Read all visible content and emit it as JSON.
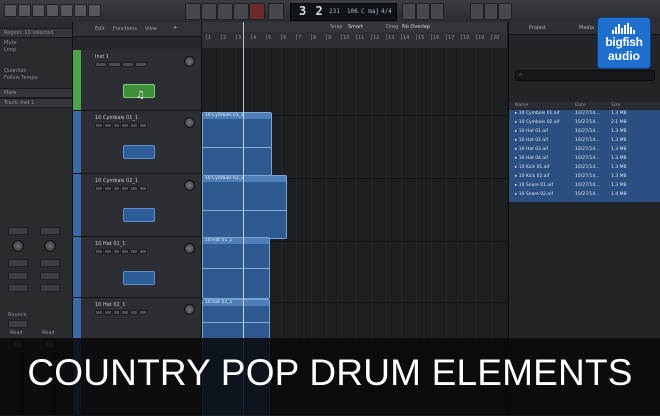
{
  "lcd": {
    "bars": "3 2",
    "beat": "231",
    "tempo": "106",
    "key": "C maj",
    "sig": "4/4"
  },
  "ruler": {
    "mode": "Snap",
    "snap_value": "Smart",
    "drag_label": "Drag",
    "drag_mode": "No Overlap",
    "bars": [
      "1",
      "2",
      "3",
      "4",
      "5",
      "6",
      "7",
      "8",
      "9",
      "10",
      "11",
      "12",
      "13",
      "14",
      "15",
      "16",
      "17",
      "18",
      "19",
      "20"
    ]
  },
  "inspector": {
    "region_label": "Region: 10 selected",
    "rows": [
      "Mute",
      "Loop",
      "",
      "Quantize",
      "Follow Tempo",
      "More"
    ],
    "track_label": "Track: Inst 1",
    "bottom": [
      "Bounce",
      "Read",
      "Read"
    ]
  },
  "track_toolbar": {
    "edit": "Edit",
    "functions": "Functions",
    "view": "View"
  },
  "tracks": [
    {
      "name": "Inst 1",
      "color": "#4aa54a"
    },
    {
      "name": "10 Cymbals 01_1",
      "color": "#3a69a6"
    },
    {
      "name": "10 Cymbals 02_1",
      "color": "#3a69a6"
    },
    {
      "name": "10 Hat 01_1",
      "color": "#3a69a6"
    },
    {
      "name": "10 Hat 02_1",
      "color": "#3a69a6"
    }
  ],
  "regions": [
    "10 Cymbals 01_1",
    "10 Cymbals 02_1",
    "10 Hat 01_1",
    "10 Hat 02_1"
  ],
  "browser": {
    "tabs": [
      "Project",
      "Media"
    ],
    "columns": [
      "Name",
      "Date",
      "Size"
    ],
    "files": [
      {
        "name": "10 Cymbals 01.aif",
        "date": "10/27/14...",
        "size": "1.3 MB"
      },
      {
        "name": "10 Cymbals 02.aif",
        "date": "10/27/14...",
        "size": "2.1 MB"
      },
      {
        "name": "10 Hat 01.aif",
        "date": "10/27/14...",
        "size": "1.3 MB"
      },
      {
        "name": "10 Hat 02.aif",
        "date": "10/27/14...",
        "size": "1.3 MB"
      },
      {
        "name": "10 Hat 03.aif",
        "date": "10/27/14...",
        "size": "1.3 MB"
      },
      {
        "name": "10 Hat 04.aif",
        "date": "10/27/14...",
        "size": "1.3 MB"
      },
      {
        "name": "10 Kick 01.aif",
        "date": "10/27/14...",
        "size": "1.3 MB"
      },
      {
        "name": "10 Kick 02.aif",
        "date": "10/27/14...",
        "size": "1.3 MB"
      },
      {
        "name": "10 Snare 01.aif",
        "date": "10/27/14...",
        "size": "1.3 MB"
      },
      {
        "name": "10 Snare 02.aif",
        "date": "10/27/14...",
        "size": "1.4 MB"
      }
    ]
  },
  "logo": {
    "line1": "bigfish",
    "line2": "audio"
  },
  "caption": "COUNTRY POP DRUM ELEMENTS",
  "colors": {
    "region": "#2f5a8f",
    "selection": "#2a4f80",
    "brand": "#1f6fcf"
  }
}
